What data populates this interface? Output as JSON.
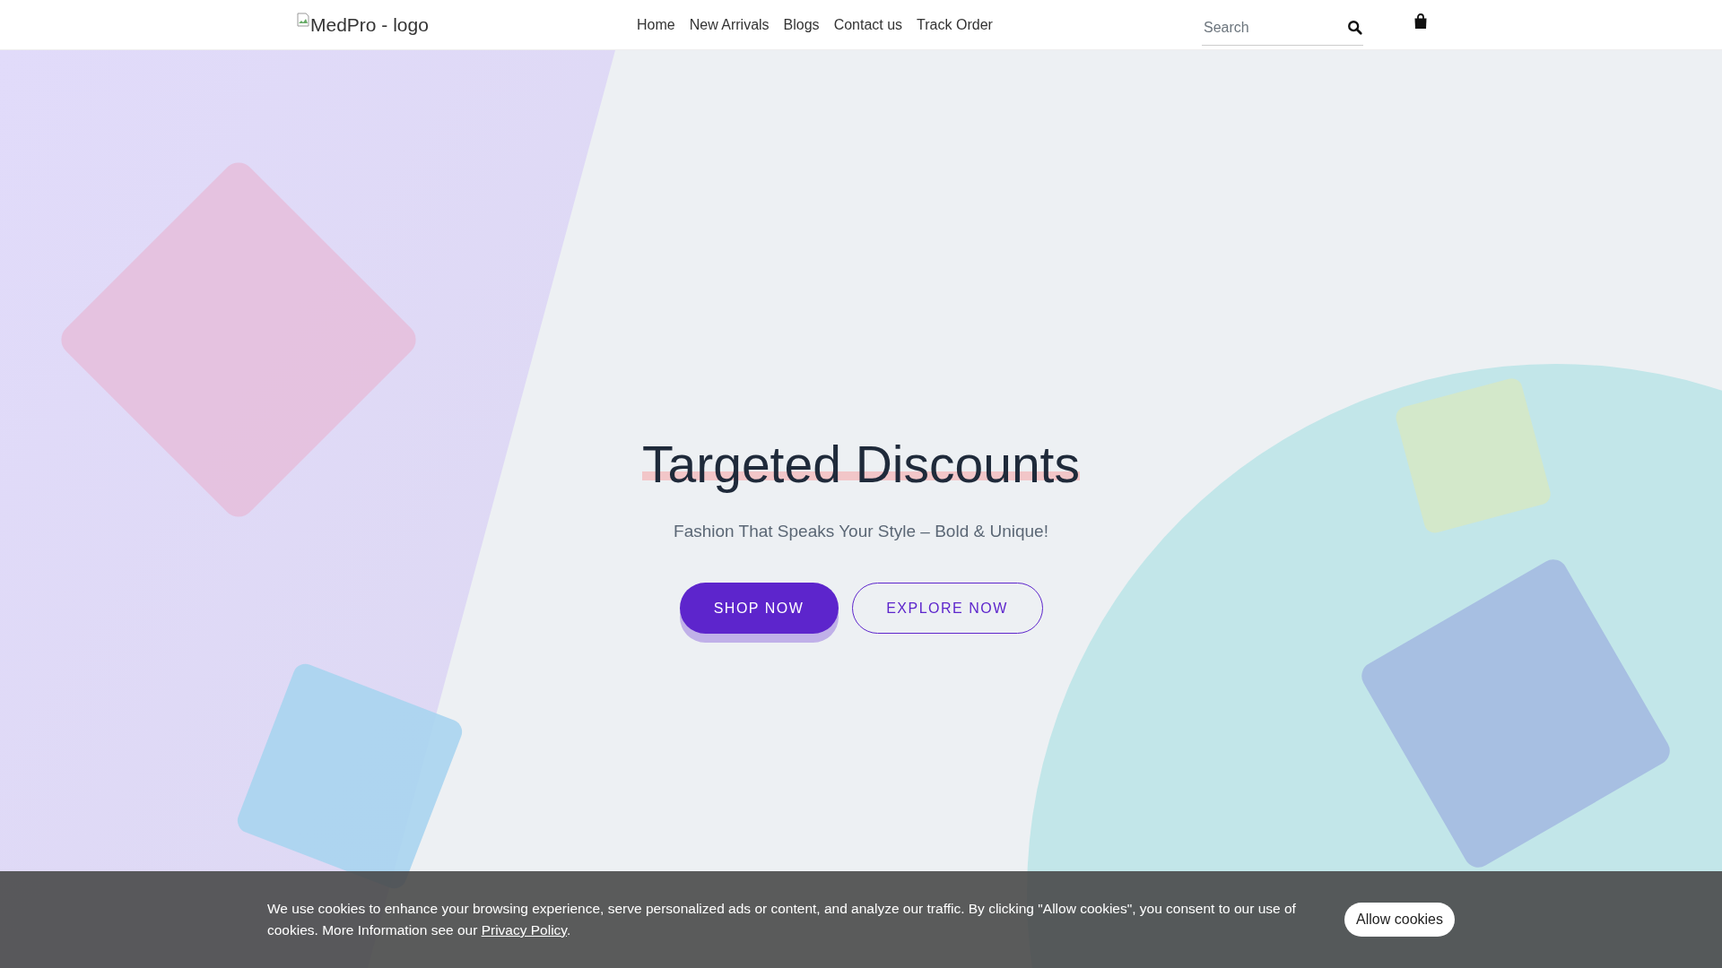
{
  "header": {
    "logo_alt": "MedPro - logo",
    "nav": [
      {
        "label": "Home"
      },
      {
        "label": "New Arrivals"
      },
      {
        "label": "Blogs"
      },
      {
        "label": "Contact us"
      },
      {
        "label": "Track Order"
      }
    ],
    "search": {
      "placeholder": "Search"
    }
  },
  "hero": {
    "title": "Targeted Discounts",
    "subtitle": "Fashion That Speaks Your Style – Bold & Unique!",
    "buttons": [
      {
        "label": "SHOP NOW",
        "kind": "primary"
      },
      {
        "label": "EXPLORE NOW",
        "kind": "outline"
      }
    ]
  },
  "cookie_banner": {
    "text": "We use cookies to enhance your browsing experience, serve personalized ads or content, and analyze our traffic. By clicking \"Allow cookies\", you consent to our use of cookies. More Information see our",
    "link": "Privacy Policy",
    "text_after": ".",
    "button": "Allow cookies"
  }
}
